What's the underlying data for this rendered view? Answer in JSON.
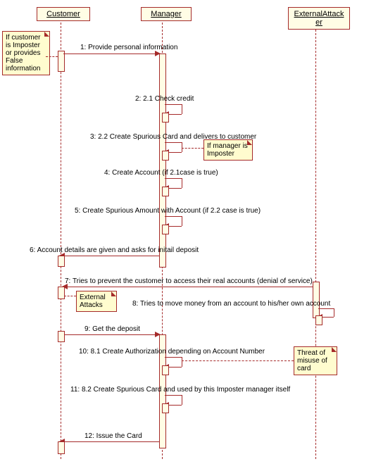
{
  "lifelines": {
    "customer": "Customer",
    "manager": "Manager",
    "attacker": "ExternalAttacker"
  },
  "notes": {
    "n1": "If customer is Imposter or provides False information",
    "n2": "If manager is Imposter",
    "n3": "External Attacks",
    "n4": "Threat of misuse of card"
  },
  "msgs": {
    "m1": "1: Provide personal information",
    "m2": "2: 2.1 Check credit",
    "m3": "3: 2.2 Create Spurious Card and delivers to customer",
    "m4": "4: Create Account  (if 2.1case is true)",
    "m5": "5: Create Spurious Amount with Account (if 2.2 case is true)",
    "m6": "6:  Account details are given and asks for initail deposit",
    "m7": "7: Tries to prevent the customer to access their real accounts (denial of service)",
    "m8": "8: Tries to move money from an account to his/her own account",
    "m9": "9: Get the deposit",
    "m10": "10: 8.1 Create Authorization depending on Account Number",
    "m11": "11: 8.2 Create Spurious Card and used by this Imposter manager itself",
    "m12": "12: Issue the Card"
  },
  "colors": {
    "stroke": "#a52a2a",
    "note_fill": "#fffccf",
    "box_fill": "#fffde5"
  }
}
